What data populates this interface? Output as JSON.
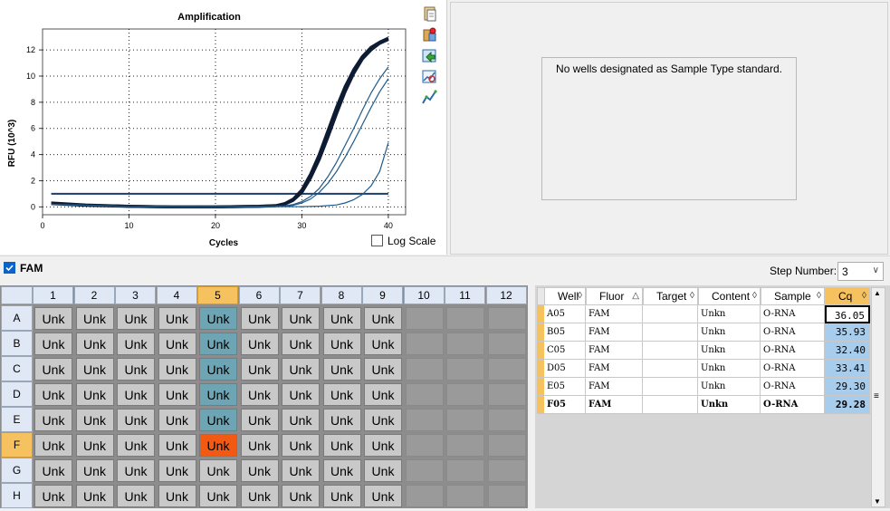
{
  "chart": {
    "title": "Amplification",
    "xlabel": "Cycles",
    "ylabel": "RFU (10^3)",
    "log_scale_label": "Log Scale",
    "log_scale_checked": false
  },
  "chart_data": {
    "type": "line",
    "title": "Amplification",
    "xlabel": "Cycles",
    "ylabel": "RFU (10^3)",
    "xlim": [
      0,
      42
    ],
    "ylim": [
      -0.6,
      13.6
    ],
    "xticks": [
      0,
      10,
      20,
      30,
      40
    ],
    "yticks": [
      0,
      2,
      4,
      6,
      8,
      10,
      12
    ],
    "grid": true,
    "threshold": 1.0,
    "series": [
      {
        "x": [
          1,
          5,
          10,
          15,
          20,
          25,
          27,
          28,
          29,
          30,
          31,
          32,
          33,
          34,
          35,
          36,
          37,
          38,
          39,
          40
        ],
        "y": [
          0.3,
          0.15,
          0.05,
          0.0,
          0.0,
          0.05,
          0.1,
          0.25,
          0.6,
          1.3,
          2.5,
          4.0,
          5.8,
          7.6,
          9.2,
          10.5,
          11.5,
          12.2,
          12.6,
          12.9
        ]
      },
      {
        "x": [
          1,
          5,
          10,
          15,
          20,
          25,
          27,
          28,
          29,
          30,
          31,
          32,
          33,
          34,
          35,
          36,
          37,
          38,
          39,
          40
        ],
        "y": [
          0.25,
          0.12,
          0.04,
          0.0,
          0.0,
          0.04,
          0.08,
          0.2,
          0.5,
          1.1,
          2.2,
          3.6,
          5.3,
          7.1,
          8.8,
          10.2,
          11.3,
          12.0,
          12.5,
          12.8
        ]
      },
      {
        "x": [
          1,
          10,
          20,
          28,
          29,
          30,
          31,
          32,
          33,
          34,
          35,
          36,
          37,
          38,
          39,
          40
        ],
        "y": [
          0.2,
          0.03,
          0.0,
          0.05,
          0.12,
          0.3,
          0.6,
          1.1,
          1.8,
          2.7,
          3.8,
          5.0,
          6.3,
          7.6,
          8.8,
          9.8
        ]
      },
      {
        "x": [
          1,
          10,
          20,
          28,
          29,
          30,
          31,
          32,
          33,
          34,
          35,
          36,
          37,
          38,
          39,
          40
        ],
        "y": [
          0.2,
          0.03,
          0.0,
          0.08,
          0.18,
          0.4,
          0.8,
          1.4,
          2.3,
          3.4,
          4.7,
          6.0,
          7.4,
          8.7,
          9.8,
          10.7
        ]
      },
      {
        "x": [
          1,
          10,
          20,
          30,
          32,
          34,
          35,
          36,
          37,
          38,
          39,
          40
        ],
        "y": [
          0.2,
          0.03,
          0.0,
          0.02,
          0.05,
          0.15,
          0.3,
          0.55,
          0.95,
          1.6,
          2.7,
          4.9
        ]
      }
    ]
  },
  "standard_panel": {
    "message": "No wells designated as Sample Type standard."
  },
  "fluor_bar": {
    "fam_label": "FAM",
    "fam_checked": true,
    "step_label": "Step Number:",
    "step_value": "3"
  },
  "plate": {
    "columns": [
      "1",
      "2",
      "3",
      "4",
      "5",
      "6",
      "7",
      "8",
      "9",
      "10",
      "11",
      "12"
    ],
    "rows": [
      "A",
      "B",
      "C",
      "D",
      "E",
      "F",
      "G",
      "H"
    ],
    "selected_column": "5",
    "selected_row": "F",
    "well_label": "Unk",
    "filled_columns": 9
  },
  "table": {
    "headers": [
      "Well",
      "Fluor",
      "Target",
      "Content",
      "Sample",
      "Cq"
    ],
    "rows": [
      [
        "A05",
        "FAM",
        "",
        "Unkn",
        "O-RNA",
        "36.05"
      ],
      [
        "B05",
        "FAM",
        "",
        "Unkn",
        "O-RNA",
        "35.93"
      ],
      [
        "C05",
        "FAM",
        "",
        "Unkn",
        "O-RNA",
        "32.40"
      ],
      [
        "D05",
        "FAM",
        "",
        "Unkn",
        "O-RNA",
        "33.41"
      ],
      [
        "E05",
        "FAM",
        "",
        "Unkn",
        "O-RNA",
        "29.30"
      ],
      [
        "F05",
        "FAM",
        "",
        "Unkn",
        "O-RNA",
        "29.28"
      ]
    ],
    "bold_row": 5
  },
  "colors": {
    "curve_dark": "#0d1b33",
    "curve_blue": "#1f5a8a",
    "threshold": "#1a3e6e",
    "teal_well": "#6ea5b4",
    "orange_well": "#f25a14"
  }
}
